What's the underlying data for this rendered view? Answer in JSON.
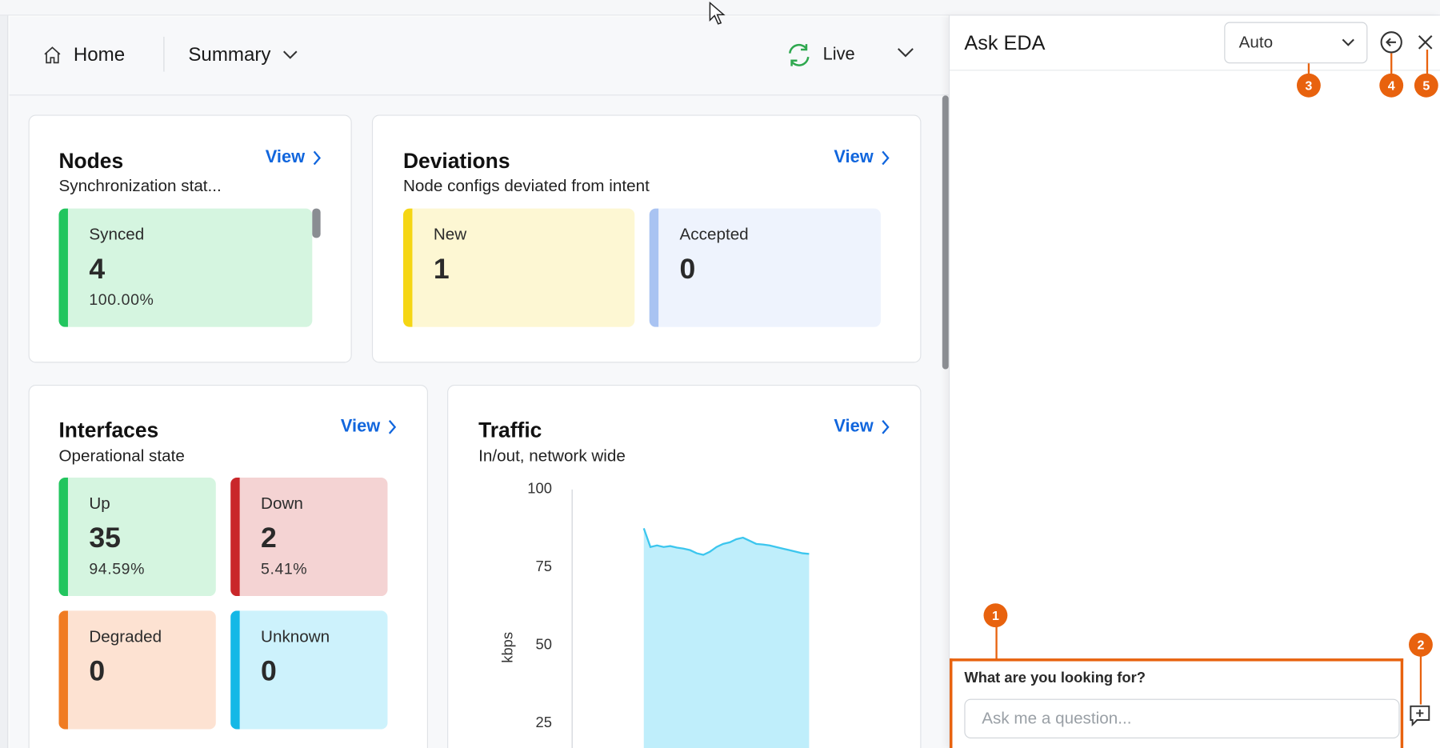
{
  "nav": {
    "home_label": "Home",
    "summary_label": "Summary",
    "live_label": "Live"
  },
  "nodes_card": {
    "title": "Nodes",
    "subtitle": "Synchronization stat...",
    "view_label": "View",
    "tiles": [
      {
        "label": "Synced",
        "value": "4",
        "percent": "100.00%",
        "color": "#22c55e",
        "bg": "#d5f5e0"
      }
    ]
  },
  "deviations_card": {
    "title": "Deviations",
    "subtitle": "Node configs deviated from intent",
    "view_label": "View",
    "tiles": [
      {
        "label": "New",
        "value": "1",
        "color": "#f5d614",
        "bg": "#fdf7d3"
      },
      {
        "label": "Accepted",
        "value": "0",
        "color": "#a9c3f2",
        "bg": "#eef3fd"
      }
    ]
  },
  "interfaces_card": {
    "title": "Interfaces",
    "subtitle": "Operational state",
    "view_label": "View",
    "tiles": [
      {
        "label": "Up",
        "value": "35",
        "percent": "94.59%",
        "color": "#22c55e",
        "bg": "#d5f5e0"
      },
      {
        "label": "Down",
        "value": "2",
        "percent": "5.41%",
        "color": "#c9272a",
        "bg": "#f4d3d3"
      },
      {
        "label": "Degraded",
        "value": "0",
        "color": "#f07b22",
        "bg": "#fde2d2"
      },
      {
        "label": "Unknown",
        "value": "0",
        "color": "#14b8e6",
        "bg": "#cdf2fc"
      }
    ]
  },
  "traffic_card": {
    "title": "Traffic",
    "subtitle": "In/out, network wide",
    "view_label": "View"
  },
  "chart_data": {
    "type": "area",
    "ylabel": "kbps",
    "yticks": [
      "100",
      "75",
      "50",
      "25"
    ],
    "ylim": [
      0,
      100
    ],
    "color": "#3cc6ee",
    "fill": "#bfeefb",
    "values": [
      87,
      81,
      81.5,
      81,
      81.3,
      80.8,
      80.5,
      80,
      79,
      78.5,
      79.5,
      81,
      82,
      82.5,
      83.5,
      84,
      83,
      82,
      81.8,
      81.5,
      81,
      80.5,
      80,
      79.5,
      79,
      78.8
    ]
  },
  "ask_panel": {
    "title": "Ask EDA",
    "model_select": "Auto",
    "prompt_label": "What are you looking for?",
    "input_placeholder": "Ask me a question...",
    "markers": [
      "1",
      "2",
      "3",
      "4",
      "5"
    ],
    "marker_color": "#e8620e"
  }
}
